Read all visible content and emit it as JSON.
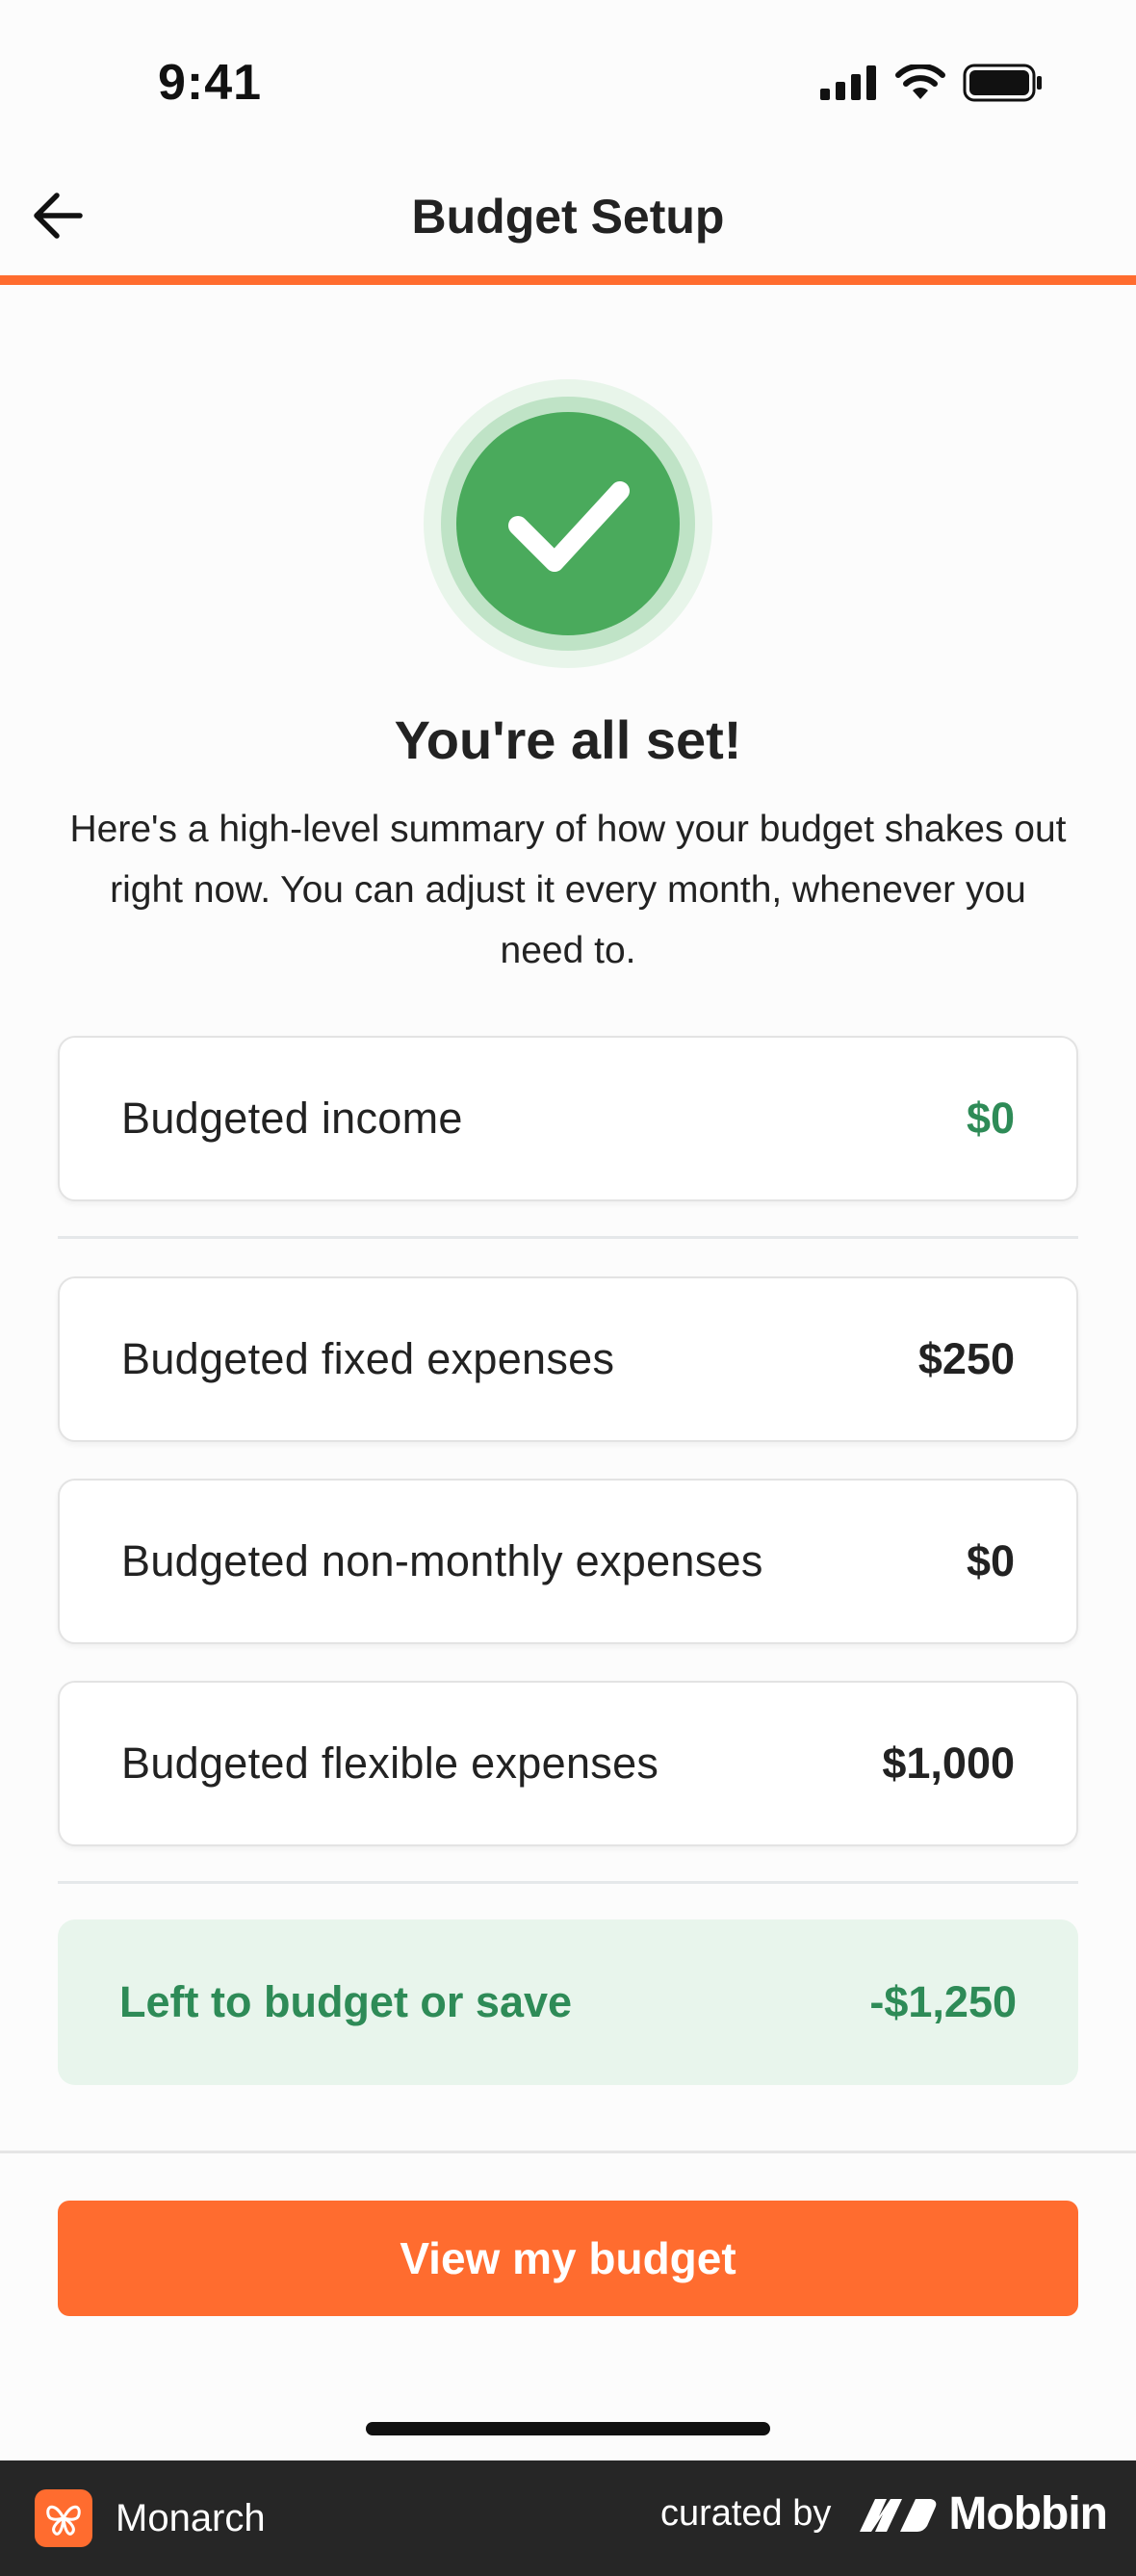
{
  "status_bar": {
    "time": "9:41"
  },
  "header": {
    "title": "Budget Setup"
  },
  "success": {
    "title": "You're all set!",
    "description": "Here's a high-level summary of how your budget shakes out right now. You can adjust it every month, whenever you need to."
  },
  "rows": [
    {
      "label": "Budgeted income",
      "value": "$0"
    },
    {
      "label": "Budgeted fixed expenses",
      "value": "$250"
    },
    {
      "label": "Budgeted non-monthly expenses",
      "value": "$0"
    },
    {
      "label": "Budgeted flexible expenses",
      "value": "$1,000"
    }
  ],
  "summary": {
    "label": "Left to budget or save",
    "value": "-$1,250"
  },
  "cta": {
    "label": "View my budget"
  },
  "bottom_bar": {
    "app_name": "Monarch",
    "curated_by": "curated by",
    "brand": "Mobbin"
  },
  "colors": {
    "accent": "#ff6c2f",
    "success": "#4aaa5c",
    "positive_text": "#2e8b57",
    "summary_bg": "#e8f5ec"
  }
}
